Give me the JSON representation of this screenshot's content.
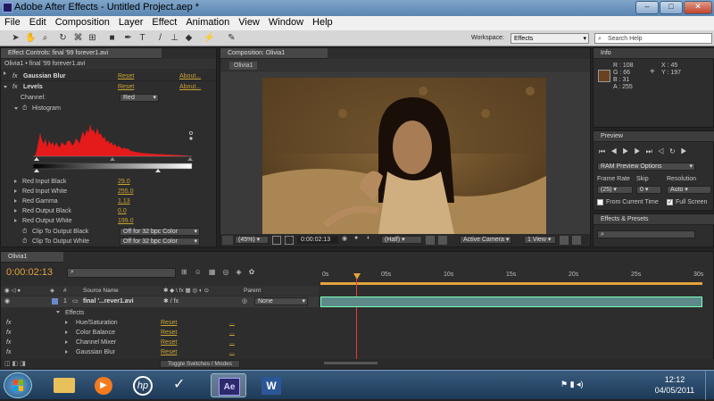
{
  "window": {
    "title": "Adobe After Effects - Untitled Project.aep *"
  },
  "menu": [
    "File",
    "Edit",
    "Composition",
    "Layer",
    "Effect",
    "Animation",
    "View",
    "Window",
    "Help"
  ],
  "workspace": {
    "label": "Workspace:",
    "value": "Effects",
    "search_placeholder": "Search Help"
  },
  "effect_controls": {
    "tab": "Effect Controls: final '99 forever1.avi",
    "subtitle": "Olivia1 • final '99 forever1.avi",
    "effects": [
      {
        "fx": "fx",
        "name": "Gaussian Blur",
        "reset": "Reset",
        "about": "About..."
      },
      {
        "fx": "fx",
        "name": "Levels",
        "reset": "Reset",
        "about": "About..."
      }
    ],
    "channel_label": "Channel:",
    "channel_value": "Red",
    "histogram_label": "Histogram",
    "params": [
      {
        "label": "Red Input Black",
        "value": "29.0"
      },
      {
        "label": "Red Input White",
        "value": "255.0"
      },
      {
        "label": "Red Gamma",
        "value": "1.13"
      },
      {
        "label": "Red Output Black",
        "value": "0.0"
      },
      {
        "label": "Red Output White",
        "value": "199.0"
      }
    ],
    "clip_black": {
      "label": "Clip To Output Black",
      "value": "Off for 32 bpc Color"
    },
    "clip_white": {
      "label": "Clip To Output White",
      "value": "Off for 32 bpc Color"
    }
  },
  "composition": {
    "tab": "Composition: Olivia1",
    "subtab": "Olivia1",
    "zoom": "(45%)",
    "timecode": "0:00:02:13",
    "resolution": "(Half)",
    "camera": "Active Camera",
    "views": "1 View"
  },
  "info": {
    "tab": "Info",
    "r": "R : 108",
    "g": "G : 66",
    "b": "B : 31",
    "a": "A : 255",
    "x": "X : 45",
    "y": "Y : 197",
    "swatch": "#6b421f"
  },
  "preview": {
    "tab": "Preview",
    "options": "RAM Preview Options",
    "frame_rate_label": "Frame Rate",
    "skip_label": "Skip",
    "resolution_label": "Resolution",
    "frame_rate": "(25)",
    "skip": "0",
    "resolution": "Auto",
    "from_current": "From Current Time",
    "full_screen": "Full Screen"
  },
  "effects_presets": {
    "tab": "Effects & Presets"
  },
  "timeline": {
    "tab": "Olivia1",
    "timecode": "0:00:02:13",
    "ruler": [
      "0s",
      "05s",
      "10s",
      "15s",
      "20s",
      "25s",
      "30s"
    ],
    "headers": {
      "source": "Source Name",
      "parent": "Parent"
    },
    "layer": {
      "index": "1",
      "name": "final '...rever1.avi",
      "parent": "None"
    },
    "effects_group": "Effects",
    "effects": [
      {
        "name": "Hue/Saturation",
        "reset": "Reset",
        "dots": "..."
      },
      {
        "name": "Color Balance",
        "reset": "Reset",
        "dots": "..."
      },
      {
        "name": "Channel Mixer",
        "reset": "Reset",
        "dots": "..."
      },
      {
        "name": "Gaussian Blur",
        "reset": "Reset",
        "dots": "..."
      }
    ],
    "toggle": "Toggle Switches / Modes"
  },
  "taskbar": {
    "time": "12:12",
    "date": "04/05/2011",
    "apps": [
      "start",
      "explorer",
      "media-player",
      "hp",
      "app",
      "after-effects",
      "word"
    ],
    "ae_label": "Ae",
    "word_label": "W"
  }
}
